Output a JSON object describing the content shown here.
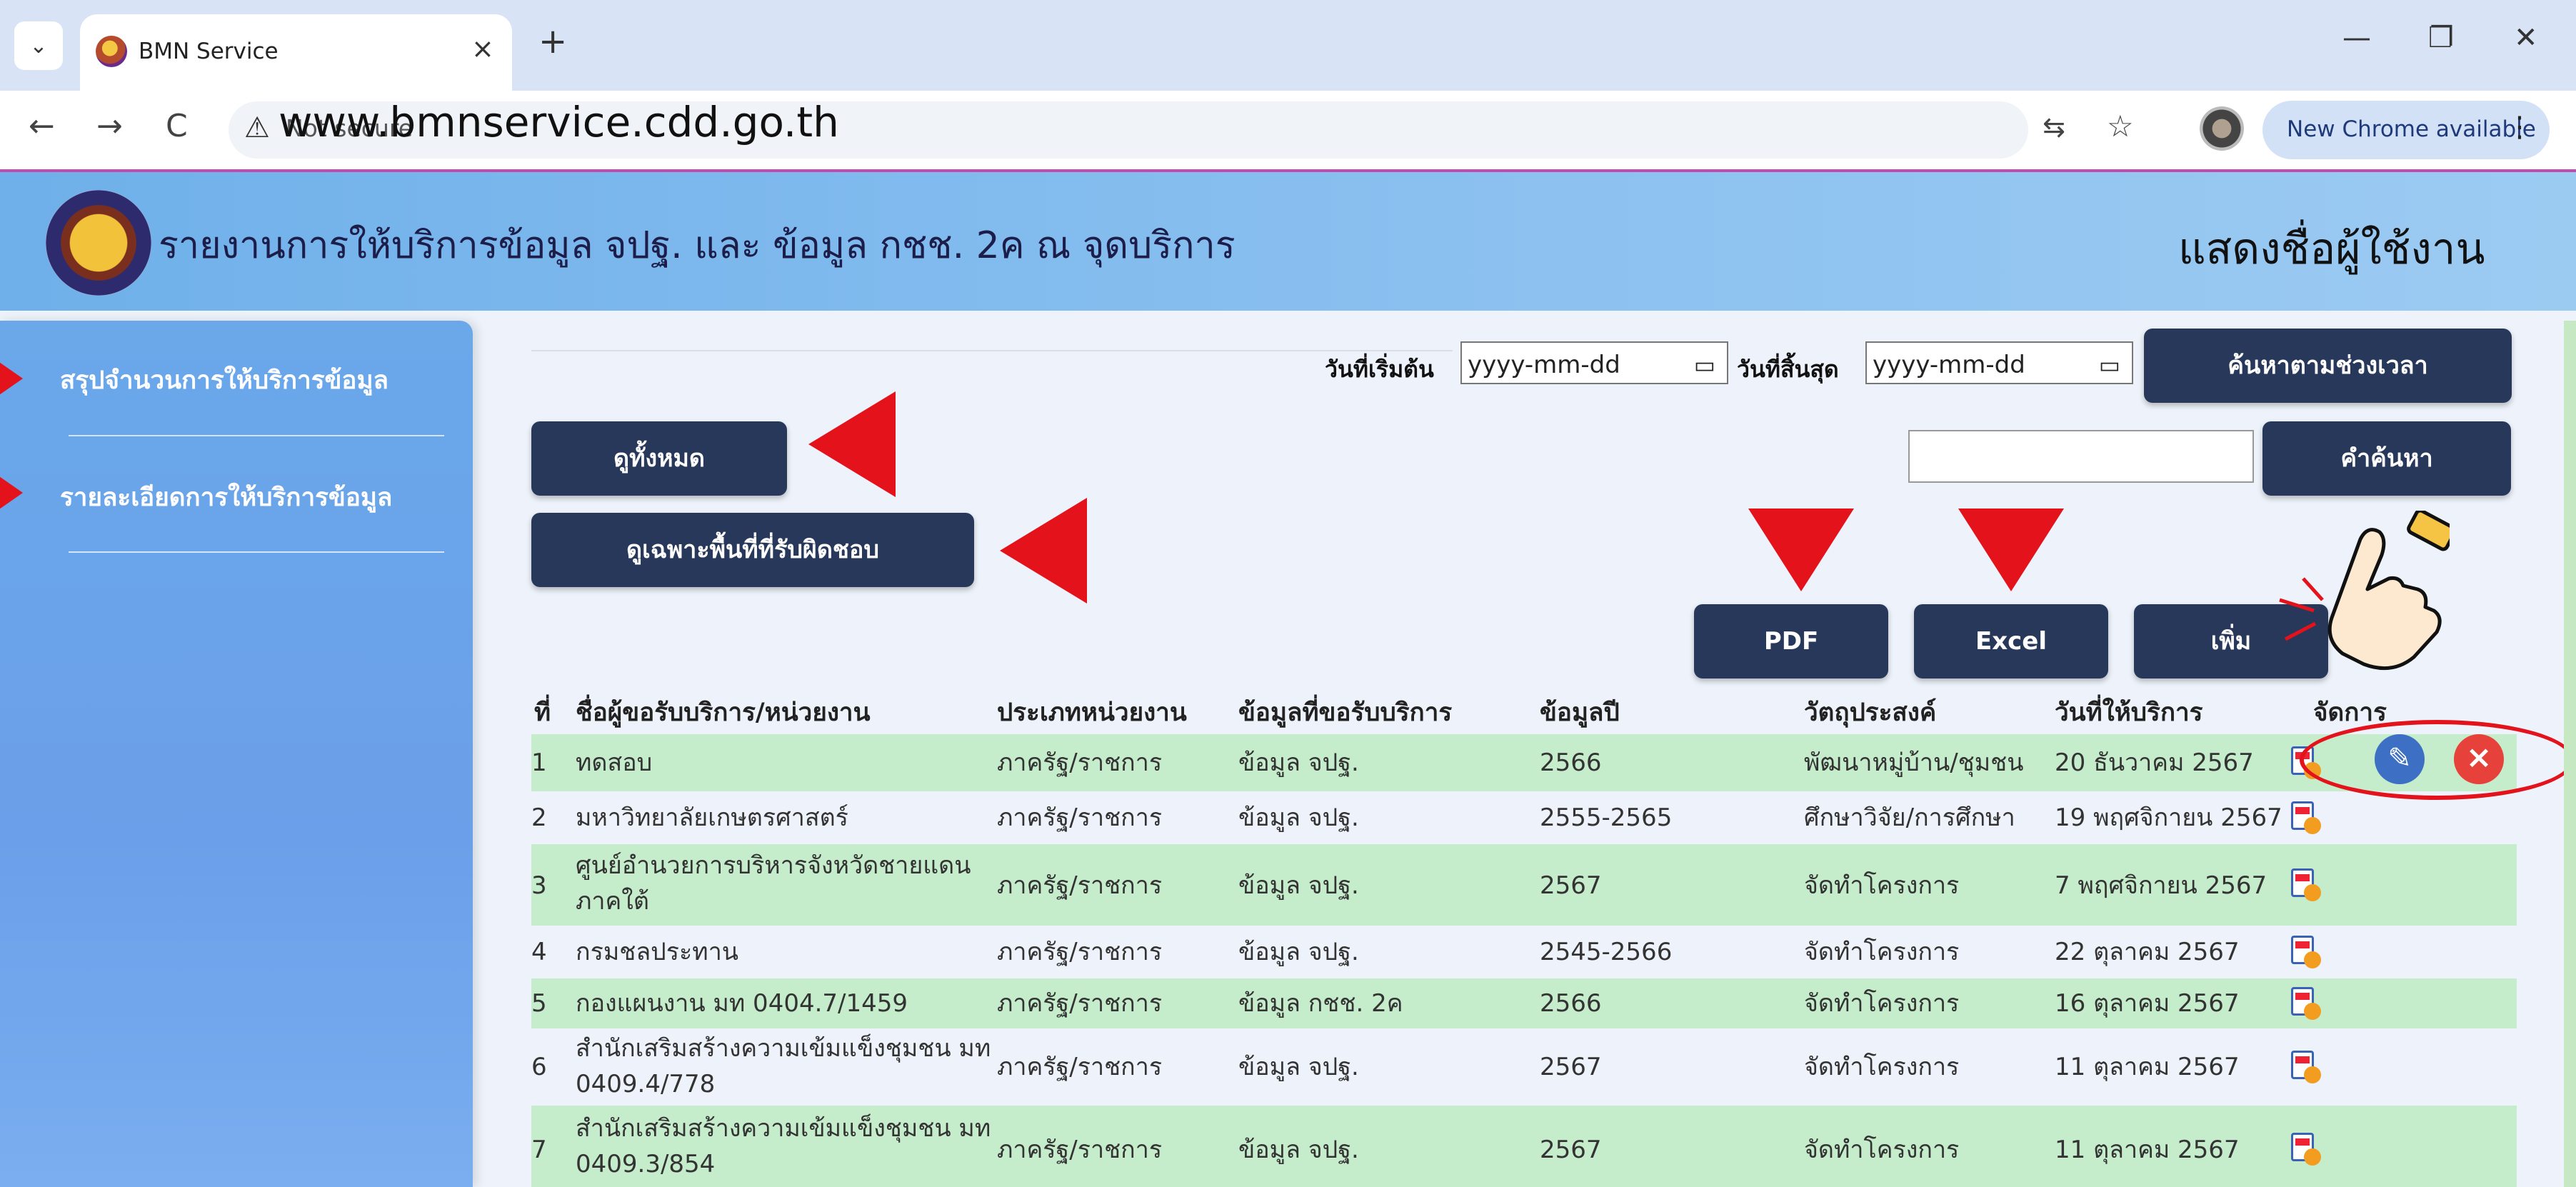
{
  "browser": {
    "tab_title": "BMN Service",
    "tab_close": "×",
    "new_tab": "+",
    "url_warning": "⚠",
    "url_notsecure": "Not secure",
    "url_overlay": "www.bmnservice.cdd.go.th",
    "update_label": "New Chrome available",
    "menu": "⋮",
    "minimize": "—",
    "restore": "❐",
    "close": "✕",
    "back": "←",
    "forward": "→",
    "reload": "C",
    "translate": "⇆",
    "star": "☆",
    "tab_dropdown": "⌄"
  },
  "header": {
    "system_title": "รายงานการให้บริการข้อมูล จปฐ. และ ข้อมูล กชช. 2ค ณ จุดบริการ",
    "user_label": "แสดงชื่อผู้ใช้งาน"
  },
  "sidebar": {
    "items": [
      {
        "label": "สรุปจำนวนการให้บริการข้อมูล"
      },
      {
        "label": "รายละเอียดการให้บริการข้อมูล"
      }
    ]
  },
  "filters": {
    "start_label": "วันที่เริ่มต้น",
    "start_placeholder": "yyyy-mm-dd",
    "end_label": "วันที่สิ้นสุด",
    "end_placeholder": "yyyy-mm-dd",
    "calendar_icon": "▭",
    "date_search_button": "ค้นหาตามช่วงเวลา",
    "keyword_button": "คำค้นหา",
    "view_all_button": "ดูทั้งหมด",
    "view_area_button": "ดูเฉพาะพื้นที่ที่รับผิดชอบ"
  },
  "actions": {
    "pdf": "PDF",
    "excel": "Excel",
    "add": "เพิ่ม"
  },
  "table": {
    "headers": [
      "ที่",
      "ชื่อผู้ขอรับบริการ/หน่วยงาน",
      "ประเภทหน่วยงาน",
      "ข้อมูลที่ขอรับบริการ",
      "ข้อมูลปี",
      "วัตถุประสงค์",
      "วันที่ให้บริการ",
      "จัดการ"
    ],
    "rows": [
      {
        "no": "1",
        "name": "ทดสอบ",
        "type": "ภาครัฐ/ราชการ",
        "data": "ข้อมูล จปฐ.",
        "year": "2566",
        "purpose": "พัฒนาหมู่บ้าน/ชุมชน",
        "date": "20 ธันวาคม 2567"
      },
      {
        "no": "2",
        "name": "มหาวิทยาลัยเกษตรศาสตร์",
        "type": "ภาครัฐ/ราชการ",
        "data": "ข้อมูล จปฐ.",
        "year": "2555-2565",
        "purpose": "ศึกษาวิจัย/การศึกษา",
        "date": "19 พฤศจิกายน 2567"
      },
      {
        "no": "3",
        "name": "ศูนย์อำนวยการบริหารจังหวัดชายแดน",
        "name2": "ภาคใต้",
        "type": "ภาครัฐ/ราชการ",
        "data": "ข้อมูล จปฐ.",
        "year": "2567",
        "purpose": "จัดทำโครงการ",
        "date": "7 พฤศจิกายน 2567"
      },
      {
        "no": "4",
        "name": "กรมชลประทาน",
        "type": "ภาครัฐ/ราชการ",
        "data": "ข้อมูล จปฐ.",
        "year": "2545-2566",
        "purpose": "จัดทำโครงการ",
        "date": "22 ตุลาคม 2567"
      },
      {
        "no": "5",
        "name": "กองแผนงาน มท 0404.7/1459",
        "type": "ภาครัฐ/ราชการ",
        "data": "ข้อมูล กชช. 2ค",
        "year": "2566",
        "purpose": "จัดทำโครงการ",
        "date": "16 ตุลาคม 2567"
      },
      {
        "no": "6",
        "name": "สำนักเสริมสร้างความเข้มแข็งชุมชน มท",
        "name2": "0409.4/778",
        "type": "ภาครัฐ/ราชการ",
        "data": "ข้อมูล จปฐ.",
        "year": "2567",
        "purpose": "จัดทำโครงการ",
        "date": "11 ตุลาคม 2567"
      },
      {
        "no": "7",
        "name": "สำนักเสริมสร้างความเข้มแข็งชุมชน มท",
        "name2": "0409.3/854",
        "type": "ภาครัฐ/ราชการ",
        "data": "ข้อมูล จปฐ.",
        "year": "2567",
        "purpose": "จัดทำโครงการ",
        "date": "11 ตุลาคม 2567"
      }
    ],
    "edit_icon": "✎",
    "delete_icon": "×"
  },
  "colors": {
    "accent_button": "#27385a",
    "row_highlight": "#c5eccb",
    "header_blue": "#6fb0ea",
    "annotation_red": "#e3121b"
  }
}
